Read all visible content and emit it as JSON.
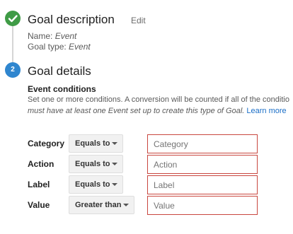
{
  "step1": {
    "title": "Goal description",
    "edit_label": "Edit",
    "name_label": "Name:",
    "name_value": "Event",
    "type_label": "Goal type:",
    "type_value": "Event"
  },
  "step2": {
    "number": "2",
    "title": "Goal details",
    "subtitle": "Event conditions",
    "description_line1": "Set one or more conditions. A conversion will be counted if all of the conditio",
    "description_line2": "must have at least one Event set up to create this type of Goal.",
    "learn_more": "Learn more"
  },
  "conditions": [
    {
      "label": "Category",
      "operator": "Equals to",
      "placeholder": "Category"
    },
    {
      "label": "Action",
      "operator": "Equals to",
      "placeholder": "Action"
    },
    {
      "label": "Label",
      "operator": "Equals to",
      "placeholder": "Label"
    },
    {
      "label": "Value",
      "operator": "Greater than",
      "placeholder": "Value"
    }
  ],
  "colors": {
    "complete_step": "#3f9b46",
    "active_step": "#2f86cf",
    "error_border": "#c9473f",
    "link": "#1a6ec7"
  },
  "icons": {
    "complete": "check-icon",
    "dropdown": "caret-down-icon"
  }
}
